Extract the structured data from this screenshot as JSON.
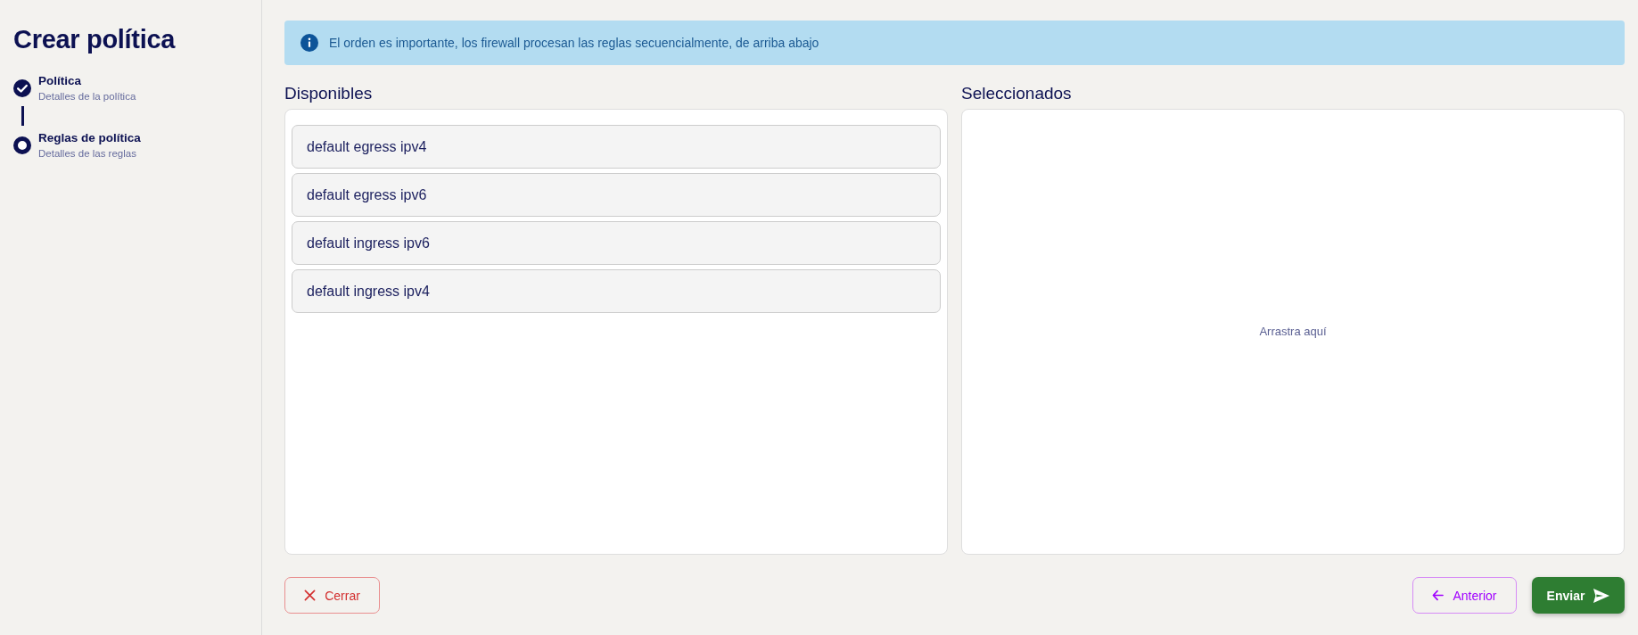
{
  "sidebar": {
    "title": "Crear política",
    "steps": [
      {
        "title": "Política",
        "subtitle": "Detalles de la política",
        "completed": true
      },
      {
        "title": "Reglas de política",
        "subtitle": "Detalles de las reglas",
        "completed": false
      }
    ]
  },
  "alert": {
    "kind": "info",
    "message": "El orden es importante, los firewall procesan las reglas secuencialmente, de arriba abajo"
  },
  "available": {
    "heading": "Disponibles",
    "items": [
      "default egress ipv4",
      "default egress ipv6",
      "default ingress ipv6",
      "default ingress ipv4"
    ]
  },
  "selected": {
    "heading": "Seleccionados",
    "empty_message": "Arrastra aquí"
  },
  "buttons": [
    {
      "label": "Cerrar",
      "kind": "close"
    },
    {
      "label": "Anterior",
      "kind": "back"
    },
    {
      "label": "Enviar",
      "kind": "submit"
    }
  ]
}
